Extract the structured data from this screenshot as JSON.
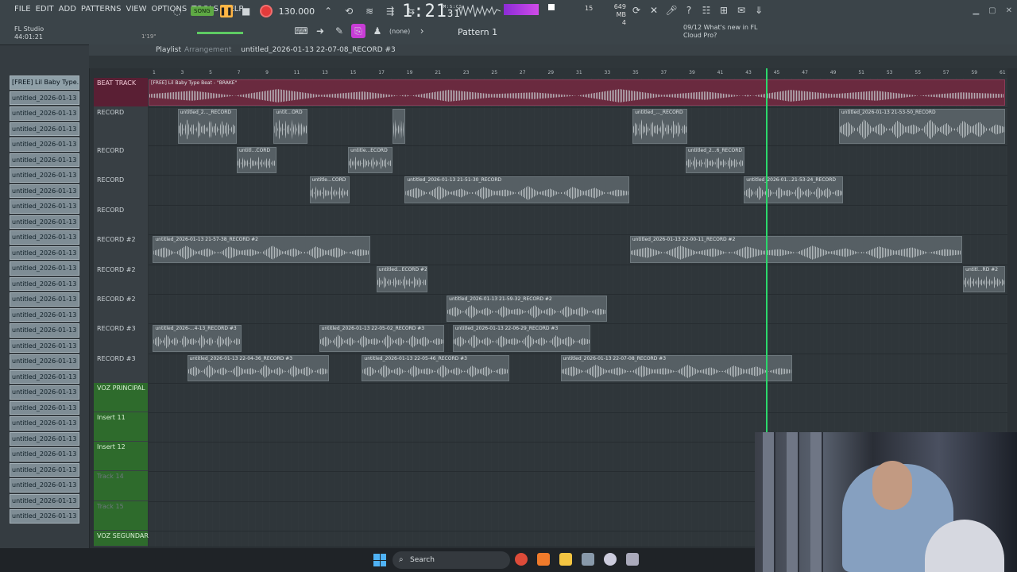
{
  "menu": [
    "FILE",
    "EDIT",
    "ADD",
    "PATTERNS",
    "VIEW",
    "OPTIONS",
    "TOOLS",
    "HELP"
  ],
  "app": {
    "name": "FL Studio",
    "time": "44:01:21",
    "hint_time": "1'19\""
  },
  "transport": {
    "mode": "SONG",
    "tempo": "130.000"
  },
  "clock": {
    "main": "1:21",
    "sub": "31",
    "unit": "M:S:CS"
  },
  "poly": {
    "value": "15"
  },
  "memory": {
    "mb": "649 MB",
    "cores": "4"
  },
  "toolbar2": {
    "snap": "(none)",
    "pattern": "Pattern 1"
  },
  "news": {
    "date": "09/12",
    "text": "What's new in FL",
    "text2": "Cloud Pro?"
  },
  "playlist": {
    "title": "Playlist",
    "subtitle": "Arrangement",
    "pattern": "untitled_2026-01-13 22-07-08_RECORD #3"
  },
  "ruler": [
    "1",
    "3",
    "5",
    "7",
    "9",
    "11",
    "13",
    "15",
    "17",
    "19",
    "21",
    "23",
    "25",
    "27",
    "29",
    "31",
    "33",
    "35",
    "37",
    "39",
    "41",
    "43",
    "45",
    "47",
    "49",
    "51",
    "53",
    "55",
    "57",
    "59",
    "61"
  ],
  "browser": [
    "[FREE] Lil Baby Type...",
    "untitled_2026-01-13 21-",
    "untitled_2026-01-13 21-",
    "untitled_2026-01-13 21-",
    "untitled_2026-01-13 21-",
    "untitled_2026-01-13 21-",
    "untitled_2026-01-13 21-",
    "untitled_2026-01-13 21-",
    "untitled_2026-01-13 21-",
    "untitled_2026-01-13 21-",
    "untitled_2026-01-13 21-",
    "untitled_2026-01-13 21-",
    "untitled_2026-01-13 21-",
    "untitled_2026-01-13 21-",
    "untitled_2026-01-13 21-",
    "untitled_2026-01-13 21-",
    "untitled_2026-01-13 21-",
    "untitled_2026-01-13 21-",
    "untitled_2026-01-13 21-",
    "untitled_2026-01-13 21-",
    "untitled_2026-01-13 21-",
    "untitled_2026-01-13 21-",
    "untitled_2026-01-13 21-",
    "untitled_2026-01-13 21-",
    "untitled_2026-01-13 21-",
    "untitled_2026-01-13 22-",
    "untitled_2026-01-13 22-",
    "untitled_2026-01-13 22-",
    "untitled_2026-01-13 22-"
  ],
  "tracks": [
    {
      "name": "BEAT TRACK",
      "style": "beat"
    },
    {
      "name": "RECORD",
      "style": "normal"
    },
    {
      "name": "RECORD",
      "style": "normal"
    },
    {
      "name": "RECORD",
      "style": "normal"
    },
    {
      "name": "RECORD",
      "style": "normal"
    },
    {
      "name": "RECORD #2",
      "style": "normal"
    },
    {
      "name": "RECORD #2",
      "style": "normal"
    },
    {
      "name": "RECORD #2",
      "style": "normal"
    },
    {
      "name": "RECORD #3",
      "style": "normal"
    },
    {
      "name": "RECORD #3",
      "style": "normal"
    },
    {
      "name": "VOZ PRINCIPAL",
      "style": "green"
    },
    {
      "name": "Insert 11",
      "style": "green"
    },
    {
      "name": "Insert 12",
      "style": "green"
    },
    {
      "name": "Track 14",
      "style": "greendim"
    },
    {
      "name": "Track 15",
      "style": "greendim"
    },
    {
      "name": "VOZ SEGUNDARIA",
      "style": "green"
    }
  ],
  "clips": [
    {
      "lane": 0,
      "start": 0,
      "end": 100,
      "label": "[FREE] Lil Baby Type Beat - \"BRAKE\"",
      "beat": true
    },
    {
      "lane": 1,
      "start": 3.4,
      "end": 10.3,
      "label": "untitled_2..._RECORD"
    },
    {
      "lane": 1,
      "start": 14.6,
      "end": 18.6,
      "label": "untit...ORD"
    },
    {
      "lane": 1,
      "start": 28.5,
      "end": 30,
      "label": ""
    },
    {
      "lane": 1,
      "start": 56.5,
      "end": 62.9,
      "label": "untitled_..._RECORD"
    },
    {
      "lane": 1,
      "start": 80.6,
      "end": 100,
      "label": "untitled_2026-01-13 21-53-50_RECORD"
    },
    {
      "lane": 2,
      "start": 10.3,
      "end": 14.9,
      "label": "untitl...CORD"
    },
    {
      "lane": 2,
      "start": 23.3,
      "end": 28.5,
      "label": "untitle...ECORD"
    },
    {
      "lane": 2,
      "start": 62.7,
      "end": 69.6,
      "label": "untitled_2...6_RECORD"
    },
    {
      "lane": 3,
      "start": 18.8,
      "end": 23.5,
      "label": "untitle...CORD"
    },
    {
      "lane": 3,
      "start": 29.9,
      "end": 56.1,
      "label": "untitled_2026-01-13 21-51-30_RECORD"
    },
    {
      "lane": 3,
      "start": 69.5,
      "end": 81.1,
      "label": "untitled_2026-01...21-53-24_RECORD"
    },
    {
      "lane": 5,
      "start": 0.5,
      "end": 25.9,
      "label": "untitled_2026-01-13 21-57-38_RECORD #2"
    },
    {
      "lane": 5,
      "start": 56.2,
      "end": 95,
      "label": "untitled_2026-01-13 22-00-11_RECORD #2"
    },
    {
      "lane": 6,
      "start": 26.6,
      "end": 32.6,
      "label": "untitled...ECORD #2"
    },
    {
      "lane": 6,
      "start": 95.1,
      "end": 100,
      "label": "untitl...RD #2"
    },
    {
      "lane": 7,
      "start": 34.8,
      "end": 53.5,
      "label": "untitled_2026-01-13 21-59-32_RECORD #2"
    },
    {
      "lane": 8,
      "start": 0.5,
      "end": 10.9,
      "label": "untitled_2026-...4-13_RECORD #3"
    },
    {
      "lane": 8,
      "start": 19.9,
      "end": 34.5,
      "label": "untitled_2026-01-13 22-05-02_RECORD #3"
    },
    {
      "lane": 8,
      "start": 35.5,
      "end": 51.6,
      "label": "untitled_2026-01-13 22-06-29_RECORD #3"
    },
    {
      "lane": 9,
      "start": 4.5,
      "end": 21.1,
      "label": "untitled_2026-01-13 22-04-36_RECORD #3"
    },
    {
      "lane": 9,
      "start": 24.9,
      "end": 42.1,
      "label": "untitled_2026-01-13 22-05-46_RECORD #3"
    },
    {
      "lane": 9,
      "start": 48.1,
      "end": 75.1,
      "label": "untitled_2026-01-13 22-07-08_RECORD #3"
    }
  ],
  "taskbar": {
    "search": "Search"
  }
}
